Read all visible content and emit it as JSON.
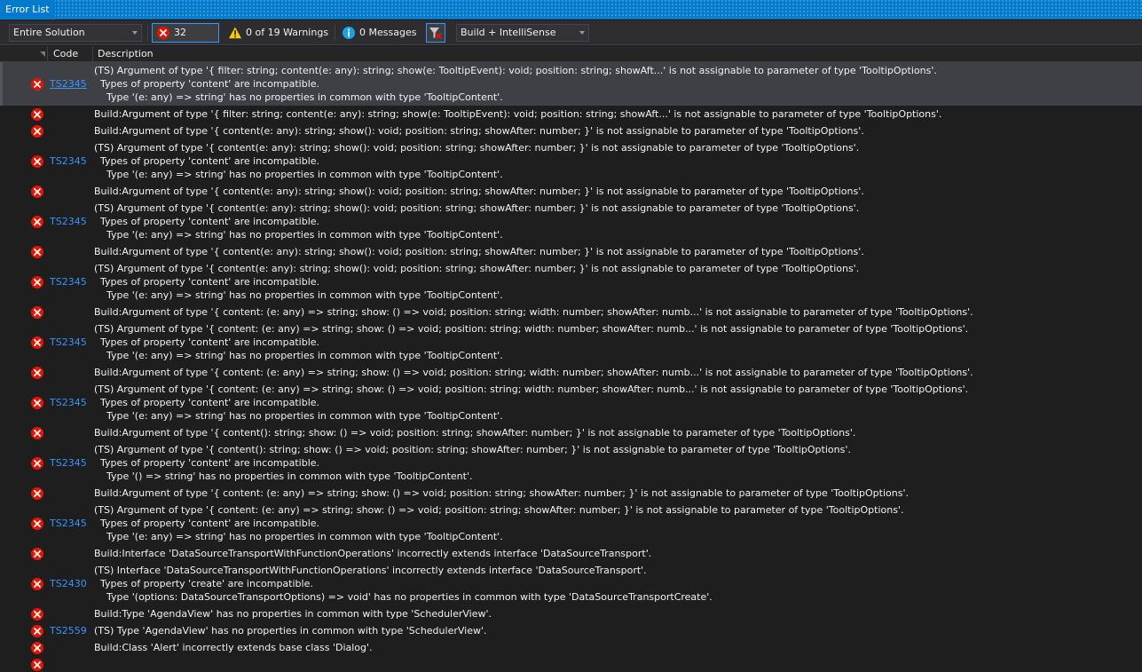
{
  "panel": {
    "title": "Error List"
  },
  "toolbar": {
    "scope": "Entire Solution",
    "errors_label": "32 Errors",
    "warnings_label": "0 of 19 Warnings",
    "messages_label": "0 Messages",
    "source": "Build + IntelliSense"
  },
  "columns": {
    "code": "Code",
    "description": "Description"
  },
  "colors": {
    "error_red": "#e51400",
    "link_blue": "#3794ff",
    "accent": "#007acc"
  },
  "rows": [
    {
      "code": "TS2345",
      "lines": [
        "(TS) Argument of type '{ filter: string; content(e: any): string; show(e: TooltipEvent): void; position: string; showAft...' is not assignable to parameter of type 'TooltipOptions'.",
        "  Types of property 'content' are incompatible.",
        "    Type '(e: any) => string' has no properties in common with type 'TooltipContent'."
      ]
    },
    {
      "code": "",
      "lines": [
        "Build:Argument of type '{ filter: string; content(e: any): string; show(e: TooltipEvent): void; position: string; showAft...' is not assignable to parameter of type 'TooltipOptions'."
      ]
    },
    {
      "code": "",
      "lines": [
        "Build:Argument of type '{ content(e: any): string; show(): void; position: string; showAfter: number; }' is not assignable to parameter of type 'TooltipOptions'."
      ]
    },
    {
      "code": "TS2345",
      "lines": [
        "(TS) Argument of type '{ content(e: any): string; show(): void; position: string; showAfter: number; }' is not assignable to parameter of type 'TooltipOptions'.",
        "  Types of property 'content' are incompatible.",
        "    Type '(e: any) => string' has no properties in common with type 'TooltipContent'."
      ]
    },
    {
      "code": "",
      "lines": [
        "Build:Argument of type '{ content(e: any): string; show(): void; position: string; showAfter: number; }' is not assignable to parameter of type 'TooltipOptions'."
      ]
    },
    {
      "code": "TS2345",
      "lines": [
        "(TS) Argument of type '{ content(e: any): string; show(): void; position: string; showAfter: number; }' is not assignable to parameter of type 'TooltipOptions'.",
        "  Types of property 'content' are incompatible.",
        "    Type '(e: any) => string' has no properties in common with type 'TooltipContent'."
      ]
    },
    {
      "code": "",
      "lines": [
        "Build:Argument of type '{ content(e: any): string; show(): void; position: string; showAfter: number; }' is not assignable to parameter of type 'TooltipOptions'."
      ]
    },
    {
      "code": "TS2345",
      "lines": [
        "(TS) Argument of type '{ content(e: any): string; show(): void; position: string; showAfter: number; }' is not assignable to parameter of type 'TooltipOptions'.",
        "  Types of property 'content' are incompatible.",
        "    Type '(e: any) => string' has no properties in common with type 'TooltipContent'."
      ]
    },
    {
      "code": "",
      "lines": [
        "Build:Argument of type '{ content: (e: any) => string; show: () => void; position: string; width: number; showAfter: numb...' is not assignable to parameter of type 'TooltipOptions'."
      ]
    },
    {
      "code": "TS2345",
      "lines": [
        "(TS) Argument of type '{ content: (e: any) => string; show: () => void; position: string; width: number; showAfter: numb...' is not assignable to parameter of type 'TooltipOptions'.",
        "  Types of property 'content' are incompatible.",
        "    Type '(e: any) => string' has no properties in common with type 'TooltipContent'."
      ]
    },
    {
      "code": "",
      "lines": [
        "Build:Argument of type '{ content: (e: any) => string; show: () => void; position: string; width: number; showAfter: numb...' is not assignable to parameter of type 'TooltipOptions'."
      ]
    },
    {
      "code": "TS2345",
      "lines": [
        "(TS) Argument of type '{ content: (e: any) => string; show: () => void; position: string; width: number; showAfter: numb...' is not assignable to parameter of type 'TooltipOptions'.",
        "  Types of property 'content' are incompatible.",
        "    Type '(e: any) => string' has no properties in common with type 'TooltipContent'."
      ]
    },
    {
      "code": "",
      "lines": [
        "Build:Argument of type '{ content(): string; show: () => void; position: string; showAfter: number; }' is not assignable to parameter of type 'TooltipOptions'."
      ]
    },
    {
      "code": "TS2345",
      "lines": [
        "(TS) Argument of type '{ content(): string; show: () => void; position: string; showAfter: number; }' is not assignable to parameter of type 'TooltipOptions'.",
        "  Types of property 'content' are incompatible.",
        "    Type '() => string' has no properties in common with type 'TooltipContent'."
      ]
    },
    {
      "code": "",
      "lines": [
        "Build:Argument of type '{ content: (e: any) => string; show: () => void; position: string; showAfter: number; }' is not assignable to parameter of type 'TooltipOptions'."
      ]
    },
    {
      "code": "TS2345",
      "lines": [
        "(TS) Argument of type '{ content: (e: any) => string; show: () => void; position: string; showAfter: number; }' is not assignable to parameter of type 'TooltipOptions'.",
        "  Types of property 'content' are incompatible.",
        "    Type '(e: any) => string' has no properties in common with type 'TooltipContent'."
      ]
    },
    {
      "code": "",
      "lines": [
        "Build:Interface 'DataSourceTransportWithFunctionOperations' incorrectly extends interface 'DataSourceTransport'."
      ]
    },
    {
      "code": "TS2430",
      "lines": [
        "(TS) Interface 'DataSourceTransportWithFunctionOperations' incorrectly extends interface 'DataSourceTransport'.",
        "  Types of property 'create' are incompatible.",
        "    Type '(options: DataSourceTransportOptions) => void' has no properties in common with type 'DataSourceTransportCreate'."
      ]
    },
    {
      "code": "",
      "lines": [
        "Build:Type 'AgendaView' has no properties in common with type 'SchedulerView'."
      ]
    },
    {
      "code": "TS2559",
      "lines": [
        "(TS) Type 'AgendaView' has no properties in common with type 'SchedulerView'."
      ]
    },
    {
      "code": "",
      "lines": [
        "Build:Class 'Alert' incorrectly extends base class 'Dialog'."
      ]
    },
    {
      "code": "",
      "lines": [
        ""
      ]
    }
  ]
}
